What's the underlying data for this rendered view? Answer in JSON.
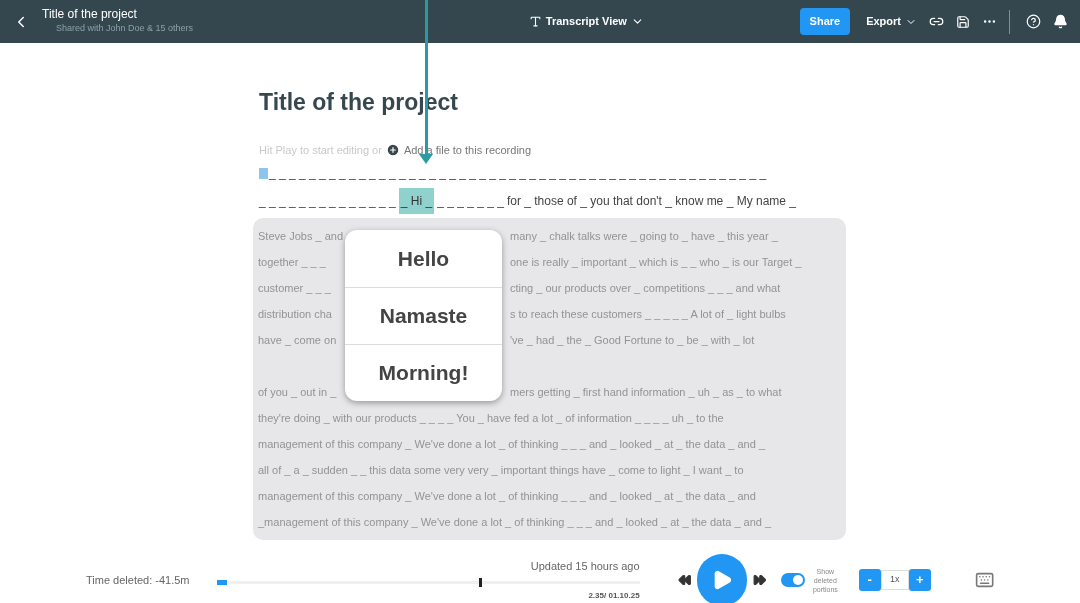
{
  "header": {
    "title": "Title of the project",
    "subtitle": "Shared with John Doe & 15 others",
    "view_label": "Transcript View",
    "share": "Share",
    "export": "Export"
  },
  "document": {
    "title": "Title of the project",
    "hint": "Hit Play to start editing or",
    "add_file": "Add a file to this recording"
  },
  "transcript": {
    "line_1": "_ _ _ _ _ _ _ _ _ _ _ _ _ _ _ _ _ _ _ _ _ _ _ _ _ _ _ _ _ _ _ _ _ _ _ _ _ _ _ _ _ _ _ _ _ _ _ _ _ _",
    "line_2_before": "_ _ _ _ _ _ _ _ _ _ _ _ _ _",
    "highlight": "_ Hi _",
    "line_2_after": "_ _ _ _ _ _ _",
    "line_2_text": "for _ those of _ you that don't _ know me _ My name _"
  },
  "deleted_lines": [
    {
      "kind": "split",
      "left": "Steve Jobs _ and",
      "right": "many _ chalk talks were _ going to _ have _ this year _"
    },
    {
      "kind": "split",
      "left": "together _ _ _",
      "right": "one is really _ important _ which is _ _ who _ is our Target _"
    },
    {
      "kind": "split",
      "left": "customer _ _ _",
      "right": "cting _ our products over _ competitions _ _ _ and what"
    },
    {
      "kind": "split",
      "left": "distribution cha",
      "right": "s to reach these customers _ _ _ _ _ A lot of _ light bulbs"
    },
    {
      "kind": "split",
      "left": "have _ come on",
      "right": "'ve _ had _ the _ Good Fortune to _ be _ with _ lot"
    },
    {
      "kind": "blank"
    },
    {
      "kind": "split",
      "left": "of you _ out in _",
      "right": "mers getting _ first hand information _ uh _ as _ to what"
    },
    {
      "kind": "full",
      "left": "they're doing _ with our products _ _ _ _ You _ have fed a lot _ of information _ _ _ _ uh _ to the"
    },
    {
      "kind": "full",
      "left": "management of this company _ We've done a lot _ of thinking _ _ _ and _ looked _ at _ the data _ and _"
    },
    {
      "kind": "full",
      "left": "all of _ a _ sudden _ _ this data some very very _ important things have _ come to light _ I want _ to"
    },
    {
      "kind": "full",
      "left": "management of this company _ We've done a lot _ of thinking _ _ _ and _ looked _ at _ the data _ and"
    },
    {
      "kind": "full",
      "left": "_management of this company _ We've done a lot _ of thinking _ _ _ and _ looked _ at _ the data _ and _"
    }
  ],
  "suggestions": [
    "Hello",
    "Namaste",
    "Morning!"
  ],
  "player": {
    "time_deleted": "Time deleted: -41.5m",
    "updated": "Updated 15 hours ago",
    "position": "2.35/ 01.10.25",
    "level": 0.62,
    "show_deleted": {
      "on": true,
      "label": "Show deleted portions"
    },
    "speed": "1x",
    "minus": "-",
    "plus": "+"
  }
}
